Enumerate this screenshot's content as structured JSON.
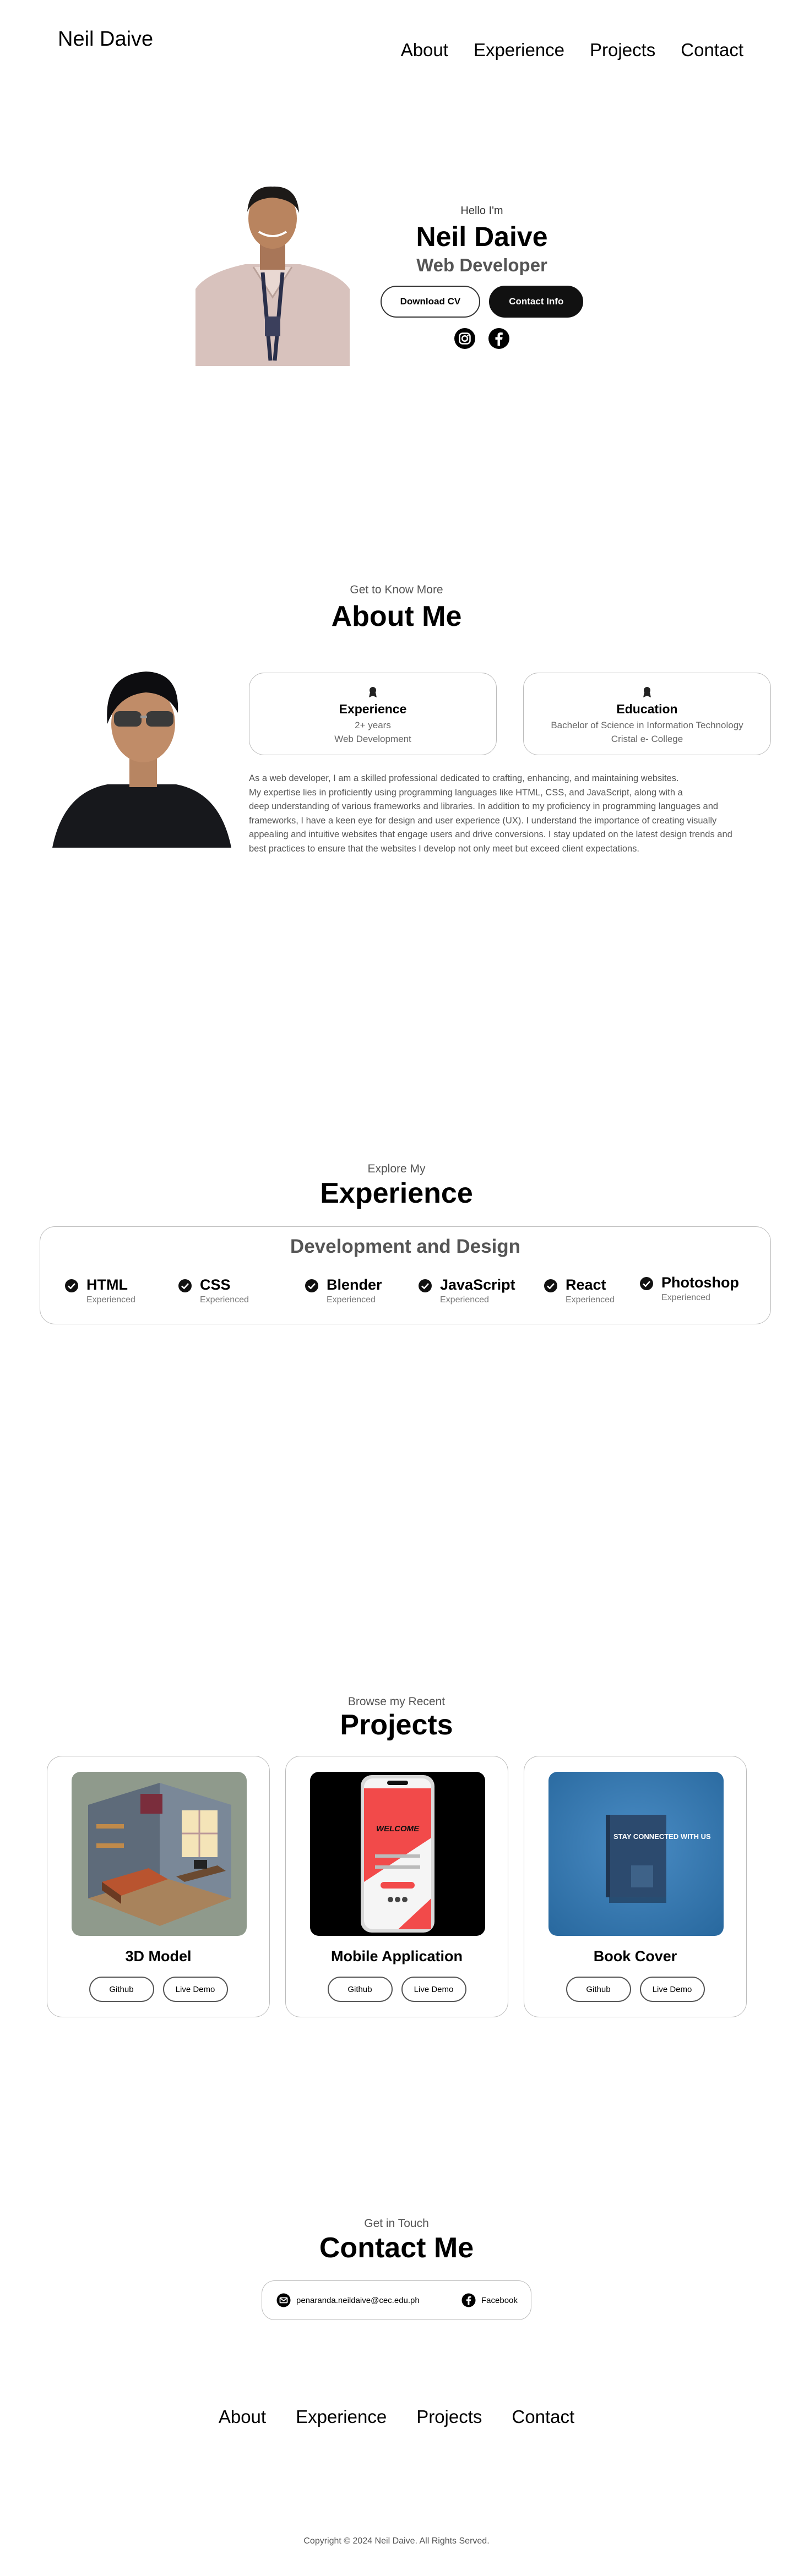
{
  "nav": {
    "logo": "Neil Daive",
    "links": [
      "About",
      "Experience",
      "Projects",
      "Contact"
    ]
  },
  "hero": {
    "greeting": "Hello I'm",
    "name": "Neil Daive",
    "title": "Web Developer",
    "download_cv": "Download CV",
    "contact_info": "Contact Info",
    "socials": [
      "instagram-icon",
      "facebook-icon"
    ]
  },
  "about": {
    "subtitle": "Get to Know More",
    "title": "About Me",
    "experience": {
      "title": "Experience",
      "line1": "2+ years",
      "line2": "Web Development"
    },
    "education": {
      "title": "Education",
      "line1": "Bachelor of Science in Information Technology",
      "line2": "Cristal e- College"
    },
    "body_lines": [
      "As a web developer, I am a skilled professional dedicated to crafting, enhancing, and maintaining websites.",
      "My expertise lies in proficiently using programming languages like HTML, CSS, and JavaScript, along with a",
      "deep understanding of various frameworks and libraries. In addition to my proficiency in programming languages and",
      "frameworks, I have a keen eye for design and user experience (UX). I understand the importance of creating visually",
      "appealing and intuitive websites that engage users and drive conversions. I stay updated on the latest design trends and",
      "best practices to ensure that the websites I develop not only meet but exceed client expectations."
    ]
  },
  "experience": {
    "subtitle": "Explore My",
    "title": "Experience",
    "box_title": "Development and Design",
    "skills": [
      {
        "name": "HTML",
        "level": "Experienced"
      },
      {
        "name": "CSS",
        "level": "Experienced"
      },
      {
        "name": "Blender",
        "level": "Experienced"
      },
      {
        "name": "JavaScript",
        "level": "Experienced"
      },
      {
        "name": "React",
        "level": "Experienced"
      },
      {
        "name": "Photoshop",
        "level": "Experienced"
      }
    ]
  },
  "projects": {
    "subtitle": "Browse my Recent",
    "title": "Projects",
    "items": [
      {
        "title": "3D Model",
        "github": "Github",
        "demo": "Live Demo"
      },
      {
        "title": "Mobile Application",
        "github": "Github",
        "demo": "Live Demo",
        "screen_title": "WELCOME"
      },
      {
        "title": "Book Cover",
        "github": "Github",
        "demo": "Live Demo",
        "book_text": "STAY CONNECTED WITH US"
      }
    ]
  },
  "contact": {
    "subtitle": "Get in Touch",
    "title": "Contact Me",
    "email": "penaranda.neildaive@cec.edu.ph",
    "facebook": "Facebook"
  },
  "footer": {
    "links": [
      "About",
      "Experience",
      "Projects",
      "Contact"
    ],
    "copyright": "Copyright © 2024 Neil Daive. All Rights Served."
  },
  "colors": {
    "accent": "#111111",
    "muted": "#555555",
    "border": "#bbbbbb"
  }
}
